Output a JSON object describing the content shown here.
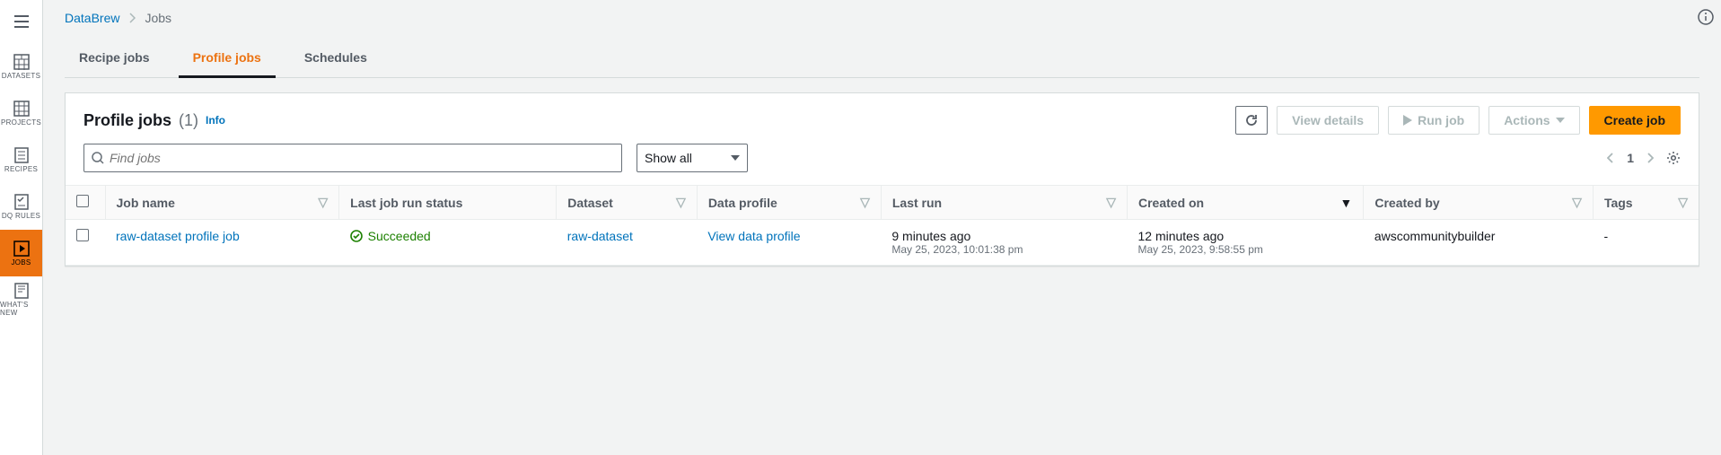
{
  "breadcrumbs": {
    "root": "DataBrew",
    "current": "Jobs"
  },
  "sidebar": {
    "items": [
      {
        "label": "DATASETS"
      },
      {
        "label": "PROJECTS"
      },
      {
        "label": "RECIPES"
      },
      {
        "label": "DQ RULES"
      },
      {
        "label": "JOBS"
      },
      {
        "label": "WHAT'S NEW"
      }
    ]
  },
  "tabs": {
    "recipe": "Recipe jobs",
    "profile": "Profile jobs",
    "schedules": "Schedules"
  },
  "panel": {
    "title": "Profile jobs",
    "count": "(1)",
    "info": "Info"
  },
  "buttons": {
    "view_details": "View details",
    "run_job": "Run job",
    "actions": "Actions",
    "create_job": "Create job"
  },
  "search": {
    "placeholder": "Find jobs"
  },
  "filter": {
    "selected": "Show all"
  },
  "pagination": {
    "page": "1"
  },
  "columns": {
    "job_name": "Job name",
    "status": "Last job run status",
    "dataset": "Dataset",
    "profile": "Data profile",
    "last_run": "Last run",
    "created_on": "Created on",
    "created_by": "Created by",
    "tags": "Tags"
  },
  "rows": [
    {
      "job_name": "raw-dataset profile job",
      "status": "Succeeded",
      "dataset": "raw-dataset",
      "profile": "View data profile",
      "last_run_rel": "9 minutes ago",
      "last_run_abs": "May 25, 2023, 10:01:38 pm",
      "created_on_rel": "12 minutes ago",
      "created_on_abs": "May 25, 2023, 9:58:55 pm",
      "created_by": "awscommunitybuilder",
      "tags": "-"
    }
  ]
}
